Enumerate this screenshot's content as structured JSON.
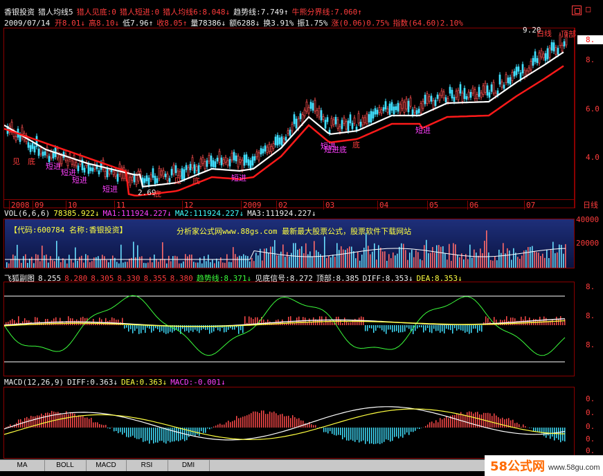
{
  "header": {
    "line1": [
      {
        "text": "香银投资",
        "color": "#f0f0f0"
      },
      {
        "text": "猎人均线5",
        "color": "#f0f0f0"
      },
      {
        "text": "猎人见底:0",
        "color": "#ff3c3c"
      },
      {
        "text": "猎人短进:0",
        "color": "#ff3c3c"
      },
      {
        "text": "猎人均线6:8.048↓",
        "color": "#ff3c3c"
      },
      {
        "text": "趋势线:7.749↑",
        "color": "#f0f0f0"
      },
      {
        "text": "牛熊分界线:7.060↑",
        "color": "#ff3c3c"
      }
    ],
    "date": "2009/07/14",
    "line2": [
      {
        "text": "开8.01↓",
        "color": "#ff3c3c"
      },
      {
        "text": "高8.10↓",
        "color": "#ff3c3c"
      },
      {
        "text": "低7.96↑",
        "color": "#f0f0f0"
      },
      {
        "text": "收8.05↑",
        "color": "#ff3c3c"
      },
      {
        "text": "量78386↓",
        "color": "#f0f0f0"
      },
      {
        "text": "额6288↓",
        "color": "#f0f0f0"
      },
      {
        "text": "换3.91%",
        "color": "#f0f0f0"
      },
      {
        "text": "振1.75%",
        "color": "#f0f0f0"
      },
      {
        "text": "涨(0.06)0.75%",
        "color": "#ff3c3c"
      },
      {
        "text": "指数(64.60)2.10%",
        "color": "#ff3c3c"
      }
    ],
    "close_icon": "close-box-icon"
  },
  "price_panel": {
    "y_ticks": [
      "8.",
      "6.0",
      "4.0"
    ],
    "current_price_label": "8.",
    "peak_label": "9.20",
    "annotations": [
      {
        "text": "见",
        "color": "#ff3c3c"
      },
      {
        "text": "底",
        "color": "#ff3c3c"
      },
      {
        "text": "短进",
        "color": "#ff40ff"
      },
      {
        "text": "短进",
        "color": "#ff40ff"
      },
      {
        "text": "短进",
        "color": "#ff40ff"
      },
      {
        "text": "短进",
        "color": "#ff40ff"
      },
      {
        "text": "2.69",
        "color": "#f0f0f0"
      },
      {
        "text": "底",
        "color": "#ff3c3c"
      },
      {
        "text": "见",
        "color": "#ff3c3c"
      },
      {
        "text": "底",
        "color": "#ff3c3c"
      },
      {
        "text": "短进",
        "color": "#ff40ff"
      },
      {
        "text": "短进",
        "color": "#ff40ff"
      },
      {
        "text": "底",
        "color": "#ff3c3c"
      },
      {
        "text": "短进底",
        "color": "#ff40ff"
      },
      {
        "text": "短进",
        "color": "#ff40ff"
      },
      {
        "text": "白线",
        "color": "#ff3c3c"
      },
      {
        "text": "顶部",
        "color": "#ff3c3c"
      }
    ],
    "x_labels": [
      "2008",
      "09",
      "10",
      "11",
      "12",
      "2009",
      "02",
      "03",
      "04",
      "05",
      "06",
      "07"
    ],
    "period": "日线"
  },
  "volume_panel": {
    "title_items": [
      {
        "text": "VOL(6,6,6)",
        "color": "#f0f0f0"
      },
      {
        "text": "78385.922↓",
        "color": "#ffff40"
      },
      {
        "text": "MA1:111924.227↓",
        "color": "#ff40ff"
      },
      {
        "text": "MA2:111924.227↓",
        "color": "#40ffff"
      },
      {
        "text": "MA3:111924.227↓",
        "color": "#f0f0f0"
      }
    ],
    "banner_left": "【代码:600784 名称:香银投资】",
    "banner_right": "分析家公式网www.88gs.com 最新最大股票公式，股票软件下载网站",
    "y_ticks": [
      "40000",
      "20000"
    ]
  },
  "fox_panel": {
    "title_items": [
      {
        "text": "飞狐副图",
        "color": "#f0f0f0"
      },
      {
        "text": "8.255",
        "color": "#f0f0f0"
      },
      {
        "text": "8.280",
        "color": "#ff3c3c"
      },
      {
        "text": "8.305",
        "color": "#ff3c3c"
      },
      {
        "text": "8.330",
        "color": "#ff3c3c"
      },
      {
        "text": "8.355",
        "color": "#ff3c3c"
      },
      {
        "text": "8.380",
        "color": "#ff3c3c"
      },
      {
        "text": "趋势线:8.371↓",
        "color": "#3cff3c"
      },
      {
        "text": "见底信号:8.272",
        "color": "#f0f0f0"
      },
      {
        "text": "顶部:8.385",
        "color": "#f0f0f0"
      },
      {
        "text": "DIFF:8.353↓",
        "color": "#f0f0f0"
      },
      {
        "text": "DEA:8.353↓",
        "color": "#ffff40"
      }
    ],
    "y_ticks": [
      "8.",
      "8.",
      "8."
    ]
  },
  "macd_panel": {
    "title_items": [
      {
        "text": "MACD(12,26,9)",
        "color": "#f0f0f0"
      },
      {
        "text": "DIFF:0.363↓",
        "color": "#f0f0f0"
      },
      {
        "text": "DEA:0.363↓",
        "color": "#ffff40"
      },
      {
        "text": "MACD:-0.001↓",
        "color": "#ff40ff"
      }
    ],
    "y_ticks": [
      "0.",
      "0.",
      "0.",
      "0.",
      "0."
    ]
  },
  "tabs": [
    "MA",
    "BOLL",
    "MACD",
    "RSI",
    "DMI"
  ],
  "watermark": {
    "brand": "58公式网",
    "url": "www.58gu.com"
  }
}
